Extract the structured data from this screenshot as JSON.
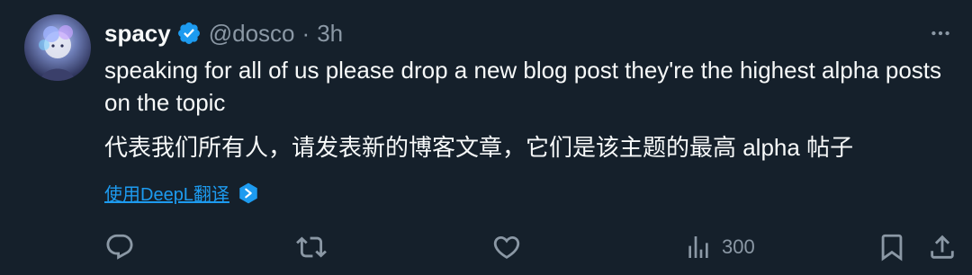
{
  "tweet": {
    "author": {
      "display_name": "spacy",
      "handle": "@dosco",
      "verified": true
    },
    "separator": "·",
    "time": "3h",
    "text_en": "speaking for all of us please drop a new blog post they're the highest alpha posts on the topic",
    "text_zh": "代表我们所有人，请发表新的博客文章，它们是该主题的最高 alpha 帖子",
    "translate_label": "使用DeepL翻译",
    "stats": {
      "views": "300"
    }
  },
  "icons": {
    "more": "more-horizontal-icon",
    "verified": "verified-badge-icon",
    "deepl": "deepl-icon",
    "reply": "reply-icon",
    "retweet": "retweet-icon",
    "like": "heart-icon",
    "views": "bar-chart-icon",
    "bookmark": "bookmark-icon",
    "share": "share-icon"
  },
  "colors": {
    "background": "#15202b",
    "text_primary": "#f7f9f9",
    "text_secondary": "#8b98a5",
    "accent": "#1d9bf0"
  }
}
